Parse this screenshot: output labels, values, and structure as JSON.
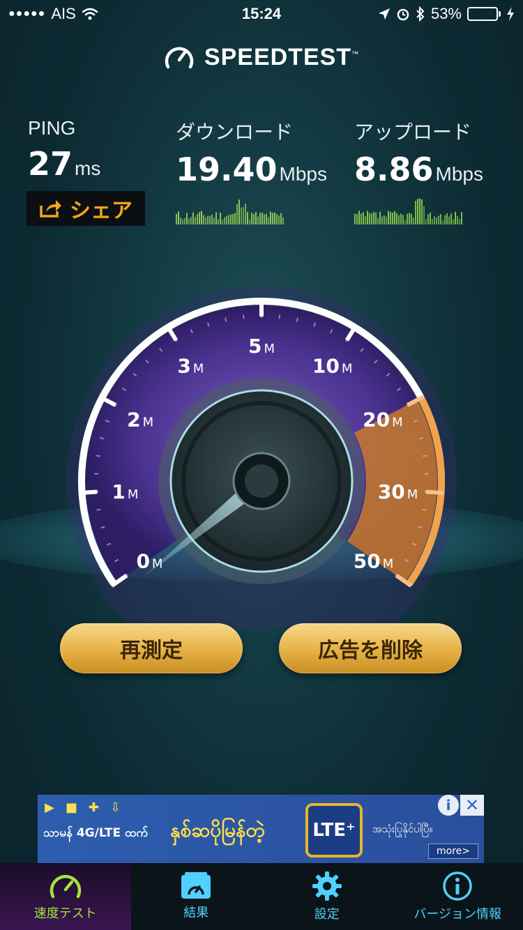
{
  "status_bar": {
    "signal": "●●●●●",
    "carrier": "AIS",
    "time": "15:24",
    "battery_percent": "53%",
    "battery_level": 0.53
  },
  "app": {
    "title": "SPEEDTEST",
    "trademark": "™"
  },
  "metrics": {
    "ping": {
      "label": "PING",
      "value": "27",
      "unit": "ms"
    },
    "download": {
      "label": "ダウンロード",
      "value": "19.40",
      "unit": "Mbps"
    },
    "upload": {
      "label": "アップロード",
      "value": "8.86",
      "unit": "Mbps"
    }
  },
  "share": {
    "label": "シェア"
  },
  "gauge": {
    "ticks": [
      {
        "num": "0",
        "unit": "M"
      },
      {
        "num": "1",
        "unit": "M"
      },
      {
        "num": "2",
        "unit": "M"
      },
      {
        "num": "3",
        "unit": "M"
      },
      {
        "num": "5",
        "unit": "M"
      },
      {
        "num": "10",
        "unit": "M"
      },
      {
        "num": "20",
        "unit": "M"
      },
      {
        "num": "30",
        "unit": "M"
      },
      {
        "num": "50",
        "unit": "M"
      }
    ],
    "colors": {
      "scale": "#5b3f9c",
      "highlight": "#c97a2c",
      "needle": "#bfe9f0"
    }
  },
  "buttons": {
    "retest": "再測定",
    "remove_ads": "広告を削除"
  },
  "ad": {
    "left_text": "သာမန် 4G/LTE ထက်",
    "headline": "နှစ်ဆပိုမြန်တဲ့",
    "lte": "LTE⁺",
    "small_text": "အသုံးပြုနိုင်ပါပြီ။",
    "more": "more>",
    "close": "✕",
    "info": "i"
  },
  "tabs": [
    {
      "label": "速度テスト",
      "active": true
    },
    {
      "label": "結果",
      "active": false
    },
    {
      "label": "設定",
      "active": false
    },
    {
      "label": "バージョン情報",
      "active": false
    }
  ]
}
